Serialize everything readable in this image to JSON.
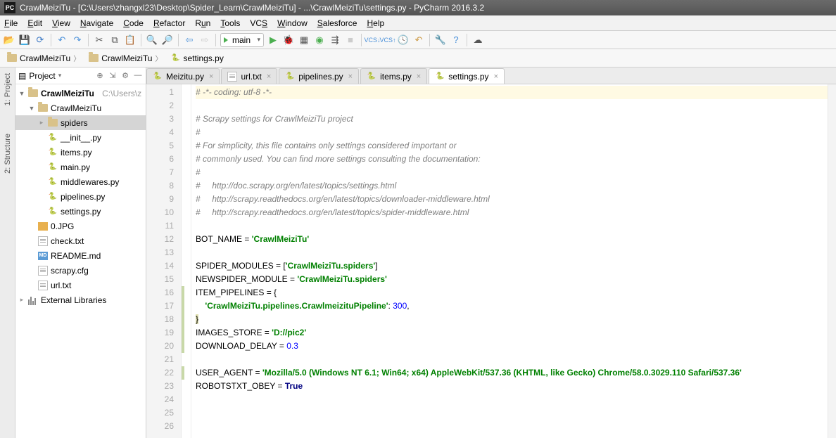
{
  "title": "CrawlMeiziTu - [C:\\Users\\zhangxl23\\Desktop\\Spider_Learn\\CrawlMeiziTu] - ...\\CrawlMeiziTu\\settings.py - PyCharm 2016.3.2",
  "menu": [
    "File",
    "Edit",
    "View",
    "Navigate",
    "Code",
    "Refactor",
    "Run",
    "Tools",
    "VCS",
    "Window",
    "Salesforce",
    "Help"
  ],
  "run_config": "main",
  "breadcrumb": [
    {
      "type": "folder",
      "label": "CrawlMeiziTu"
    },
    {
      "type": "folder",
      "label": "CrawlMeiziTu"
    },
    {
      "type": "py",
      "label": "settings.py"
    }
  ],
  "project_header": "Project",
  "tree": {
    "root": {
      "label": "CrawlMeiziTu",
      "path": "C:\\Users\\z"
    },
    "pkg": "CrawlMeiziTu",
    "spiders": "spiders",
    "files_pkg": [
      "__init__.py",
      "items.py",
      "main.py",
      "middlewares.py",
      "pipelines.py",
      "settings.py"
    ],
    "root_files": [
      {
        "label": "0.JPG",
        "icon": "jpg"
      },
      {
        "label": "check.txt",
        "icon": "txt"
      },
      {
        "label": "README.md",
        "icon": "md"
      },
      {
        "label": "scrapy.cfg",
        "icon": "txt"
      },
      {
        "label": "url.txt",
        "icon": "txt"
      }
    ],
    "ext_lib": "External Libraries"
  },
  "tabs": [
    {
      "label": "Meizitu.py",
      "active": false
    },
    {
      "label": "url.txt",
      "active": false,
      "icon": "txt"
    },
    {
      "label": "pipelines.py",
      "active": false
    },
    {
      "label": "items.py",
      "active": false
    },
    {
      "label": "settings.py",
      "active": true
    }
  ],
  "code": {
    "l1": "# -*- coding: utf-8 -*-",
    "l3": "# Scrapy settings for CrawlMeiziTu project",
    "l4": "#",
    "l5": "# For simplicity, this file contains only settings considered important or",
    "l6": "# commonly used. You can find more settings consulting the documentation:",
    "l7": "#",
    "l8": "#     http://doc.scrapy.org/en/latest/topics/settings.html",
    "l9": "#     http://scrapy.readthedocs.org/en/latest/topics/downloader-middleware.html",
    "l10": "#     http://scrapy.readthedocs.org/en/latest/topics/spider-middleware.html",
    "bot": "BOT_NAME = ",
    "bot_v": "'CrawlMeiziTu'",
    "sm": "SPIDER_MODULES = [",
    "sm_v": "'CrawlMeiziTu.spiders'",
    "nsm": "NEWSPIDER_MODULE = ",
    "nsm_v": "'CrawlMeiziTu.spiders'",
    "ip": "ITEM_PIPELINES = {",
    "ip_k": "'CrawlMeiziTu.pipelines.CrawlmeizituPipeline'",
    "ip_v": "300",
    "img": "IMAGES_STORE = ",
    "img_v": "'D://pic2'",
    "dd": "DOWNLOAD_DELAY = ",
    "dd_v": "0.3",
    "ua": "USER_AGENT = ",
    "ua_v": "'Mozilla/5.0 (Windows NT 6.1; Win64; x64) AppleWebKit/537.36 (KHTML, like Gecko) Chrome/58.0.3029.110 Safari/537.36'",
    "ro": "ROBOTSTXT_OBEY = ",
    "ro_v": "True"
  },
  "sidetabs": [
    "1: Project",
    "2: Structure"
  ]
}
